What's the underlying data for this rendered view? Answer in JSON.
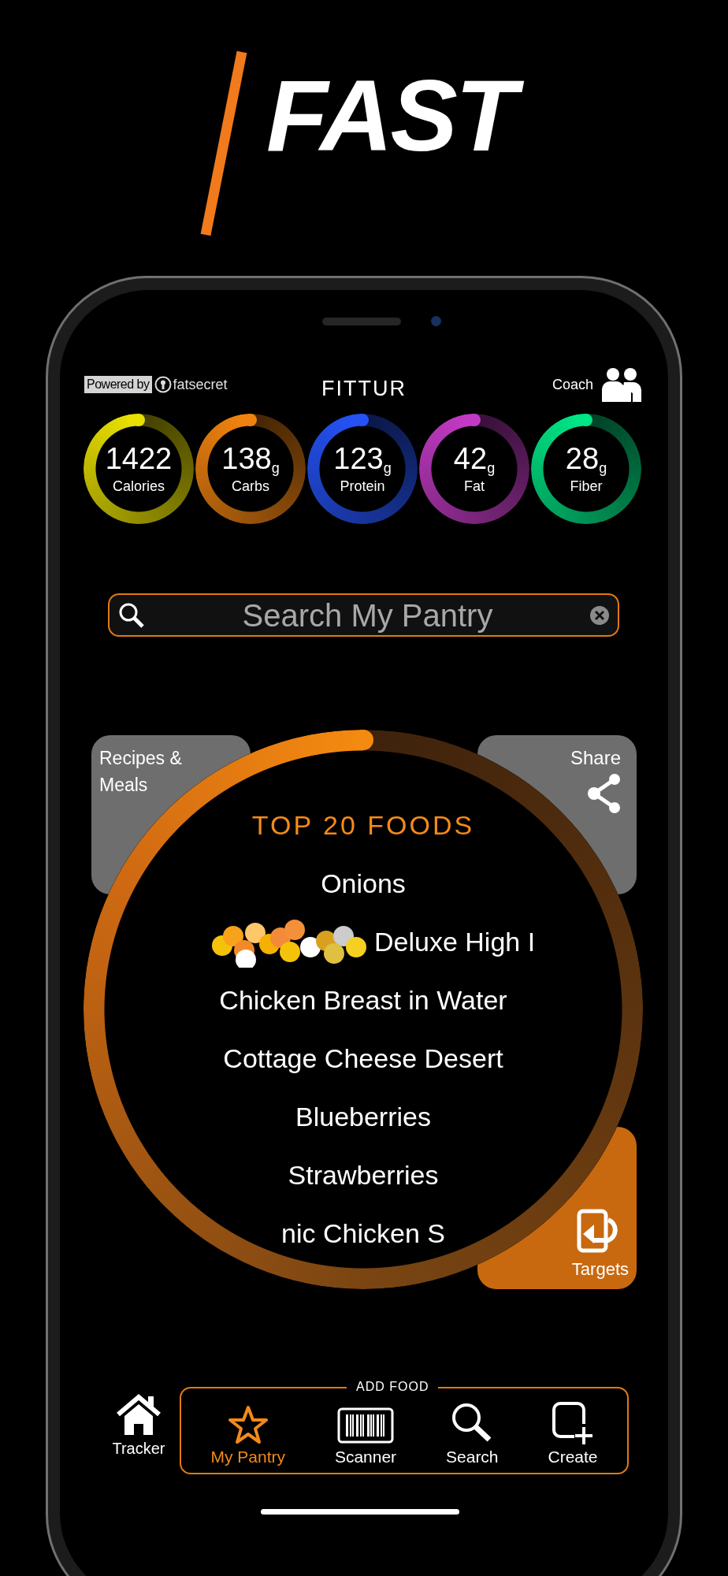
{
  "headline": "FAST",
  "app": {
    "powered_by": "Powered by",
    "provider": "fatsecret",
    "title": "FITTUR",
    "coach": "Coach"
  },
  "rings": [
    {
      "value": "1422",
      "label": "Calories",
      "color": "#e8e000"
    },
    {
      "value": "138$_{g}$",
      "label": "Carbs",
      "color": "#f0820f"
    },
    {
      "value": "123$_{g}$",
      "label": "Protein",
      "color": "#2452f5"
    },
    {
      "value": "42$_{g}$",
      "label": "Fat",
      "color": "#c23ac4"
    },
    {
      "value": "28$_{g}$",
      "label": "Fiber",
      "color": "#00e585"
    }
  ],
  "search": {
    "placeholder": "Search My Pantry"
  },
  "cards": [
    {
      "kind": "recipes",
      "label": "Recipes & Meals"
    },
    {
      "kind": "share",
      "label": "Share"
    },
    {
      "kind": "targets",
      "label": "Targets"
    }
  ],
  "top_foods": {
    "title": "TOP 20 FOODS",
    "items": [
      {
        "label": "Onions"
      },
      {
        "label": "Deluxe High I",
        "obscured": true
      },
      {
        "label": "Chicken Breast in Water"
      },
      {
        "label": "Cottage Cheese Desert"
      },
      {
        "label": "Blueberries"
      },
      {
        "label": "Strawberries"
      },
      {
        "label": "nic Chicken S"
      }
    ]
  },
  "nav": {
    "tracker": {
      "label": "Tracker",
      "selected": false
    },
    "group_label": "ADD FOOD",
    "items": [
      {
        "kind": "star",
        "label": "My Pantry",
        "selected": true
      },
      {
        "kind": "barcode",
        "label": "Scanner",
        "selected": false
      },
      {
        "kind": "search",
        "label": "Search",
        "selected": false
      },
      {
        "kind": "create",
        "label": "Create",
        "selected": false
      }
    ]
  }
}
